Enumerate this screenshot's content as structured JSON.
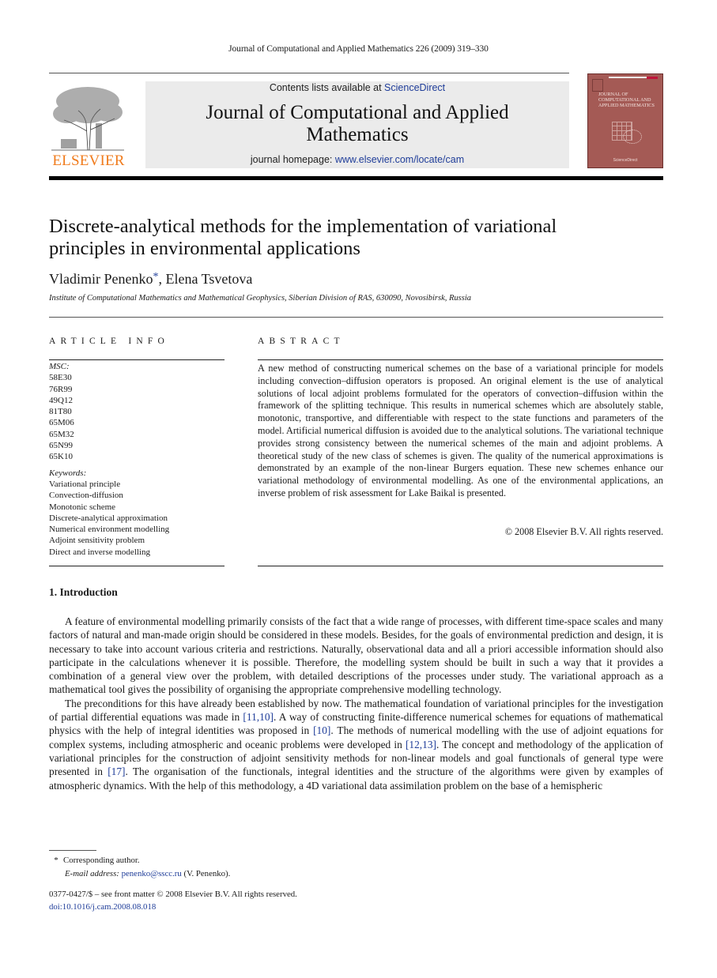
{
  "running_head": "Journal of Computational and Applied Mathematics 226 (2009) 319–330",
  "masthead": {
    "publisher_logo": "ELSEVIER",
    "contents_prefix": "Contents lists available at ",
    "contents_link": "ScienceDirect",
    "journal_title_line1": "Journal of Computational and Applied",
    "journal_title_line2": "Mathematics",
    "homepage_prefix": "journal homepage: ",
    "homepage_link": "www.elsevier.com/locate/cam",
    "cover_title": "JOURNAL OF COMPUTATIONAL AND APPLIED MATHEMATICS",
    "cover_footer": "ScienceDirect",
    "colors": {
      "link": "#1f3d99",
      "elsevier_orange": "#f07b1c",
      "cover": "#a45a55"
    }
  },
  "article": {
    "title_line1": "Discrete-analytical methods for the implementation of variational",
    "title_line2": "principles in environmental applications",
    "author1": "Vladimir Penenko",
    "author1_mark": "*",
    "author_sep": ", ",
    "author2": "Elena Tsvetova",
    "affiliation": "Institute of Computational Mathematics and Mathematical Geophysics, Siberian Division of RAS, 630090, Novosibirsk, Russia"
  },
  "article_info": {
    "heading": "ARTICLE INFO",
    "msc_label": "MSC:",
    "msc_codes": [
      "58E30",
      "76R99",
      "49Q12",
      "81T80",
      "65M06",
      "65M32",
      "65N99",
      "65K10"
    ],
    "keywords_label": "Keywords:",
    "keywords": [
      "Variational principle",
      "Convection-diffusion",
      "Monotonic scheme",
      "Discrete-analytical approximation",
      "Numerical environment modelling",
      "Adjoint sensitivity problem",
      "Direct and inverse modelling"
    ]
  },
  "abstract": {
    "heading": "ABSTRACT",
    "text": "A new method of constructing numerical schemes on the base of a variational principle for models including convection–diffusion operators is proposed. An original element is the use of analytical solutions of local adjoint problems formulated for the operators of convection–diffusion within the framework of the splitting technique. This results in numerical schemes which are absolutely stable, monotonic, transportive, and differentiable with respect to the state functions and parameters of the model. Artificial numerical diffusion is avoided due to the analytical solutions. The variational technique provides strong consistency between the numerical schemes of the main and adjoint problems. A theoretical study of the new class of schemes is given. The quality of the numerical approximations is demonstrated by an example of the non-linear Burgers equation. These new schemes enhance our variational methodology of environmental modelling. As one of the environmental applications, an inverse problem of risk assessment for Lake Baikal is presented.",
    "copyright": "© 2008 Elsevier B.V. All rights reserved."
  },
  "introduction": {
    "heading": "1.  Introduction",
    "p1": "A feature of environmental modelling primarily consists of the fact that a wide range of processes, with different time-space scales and many factors of natural and man-made origin should be considered in these models. Besides, for the goals of environmental prediction and design, it is necessary to take into account various criteria and restrictions. Naturally, observational data and all a priori accessible information should also participate in the calculations whenever it is possible. Therefore, the modelling system should be built in such a way that it provides a combination of a general view over the problem, with detailed descriptions of the processes under study. The variational approach as a mathematical tool gives the possibility of organising the appropriate comprehensive modelling technology.",
    "p2_a": "The preconditions for this have already been established by now. The mathematical foundation of variational principles for the investigation of partial differential equations was made in ",
    "ref_a": "[11,10]",
    "p2_b": ". A way of constructing finite-difference numerical schemes for equations of mathematical physics with the help of integral identities was proposed in ",
    "ref_b": "[10]",
    "p2_c": ". The methods of numerical modelling with the use of adjoint equations for complex systems, including atmospheric and oceanic problems were developed in ",
    "ref_c": "[12,13]",
    "p2_d": ". The concept and methodology of the application of variational principles for the construction of adjoint sensitivity methods for non-linear models and goal functionals of general type were presented in ",
    "ref_d": "[17]",
    "p2_e": ". The organisation of the functionals, integral identities and the structure of the algorithms were given by examples of atmospheric dynamics. With the help of this methodology, a 4D variational data assimilation problem on the base of a hemispheric"
  },
  "footnotes": {
    "star": "*",
    "corresponding": "Corresponding author.",
    "email_label": "E-mail address:",
    "email": "penenko@sscc.ru",
    "email_suffix": " (V. Penenko).",
    "front_matter": "0377-0427/$ – see front matter © 2008 Elsevier B.V. All rights reserved.",
    "doi": "doi:10.1016/j.cam.2008.08.018"
  }
}
